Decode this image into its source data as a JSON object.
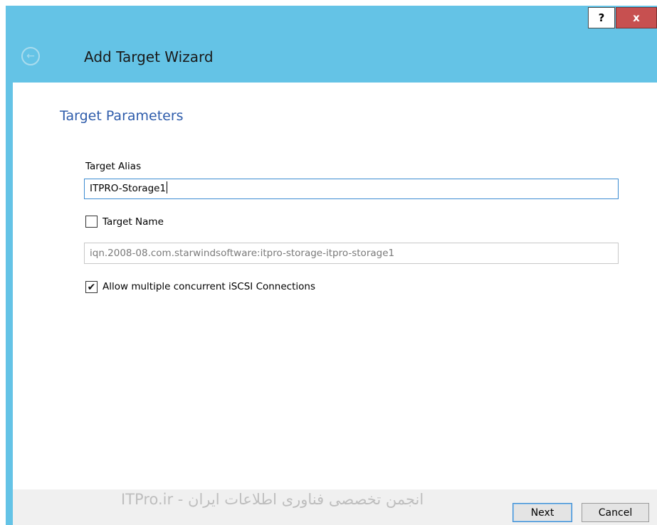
{
  "titlebar": {
    "help_label": "?",
    "close_label": "x"
  },
  "header": {
    "back_icon": "back-arrow-icon",
    "title": "Add Target Wizard"
  },
  "main": {
    "heading": "Target Parameters",
    "alias_label": "Target Alias",
    "alias_value": "ITPRO-Storage1",
    "target_name_checkbox": {
      "label": "Target Name",
      "checked": false
    },
    "target_name_value": "iqn.2008-08.com.starwindsoftware:itpro-storage-itpro-storage1",
    "concurrent_checkbox": {
      "label": "Allow multiple concurrent iSCSI Connections",
      "checked": true,
      "check_glyph": "✔"
    }
  },
  "footer": {
    "watermark": "ITPro.ir - انجمن تخصصی فناوری اطلاعات ایران",
    "next_label": "Next",
    "cancel_label": "Cancel"
  },
  "colors": {
    "accent": "#64c3e6",
    "heading": "#2e5cab",
    "close": "#c75050",
    "focus_border": "#3c8cd2"
  }
}
